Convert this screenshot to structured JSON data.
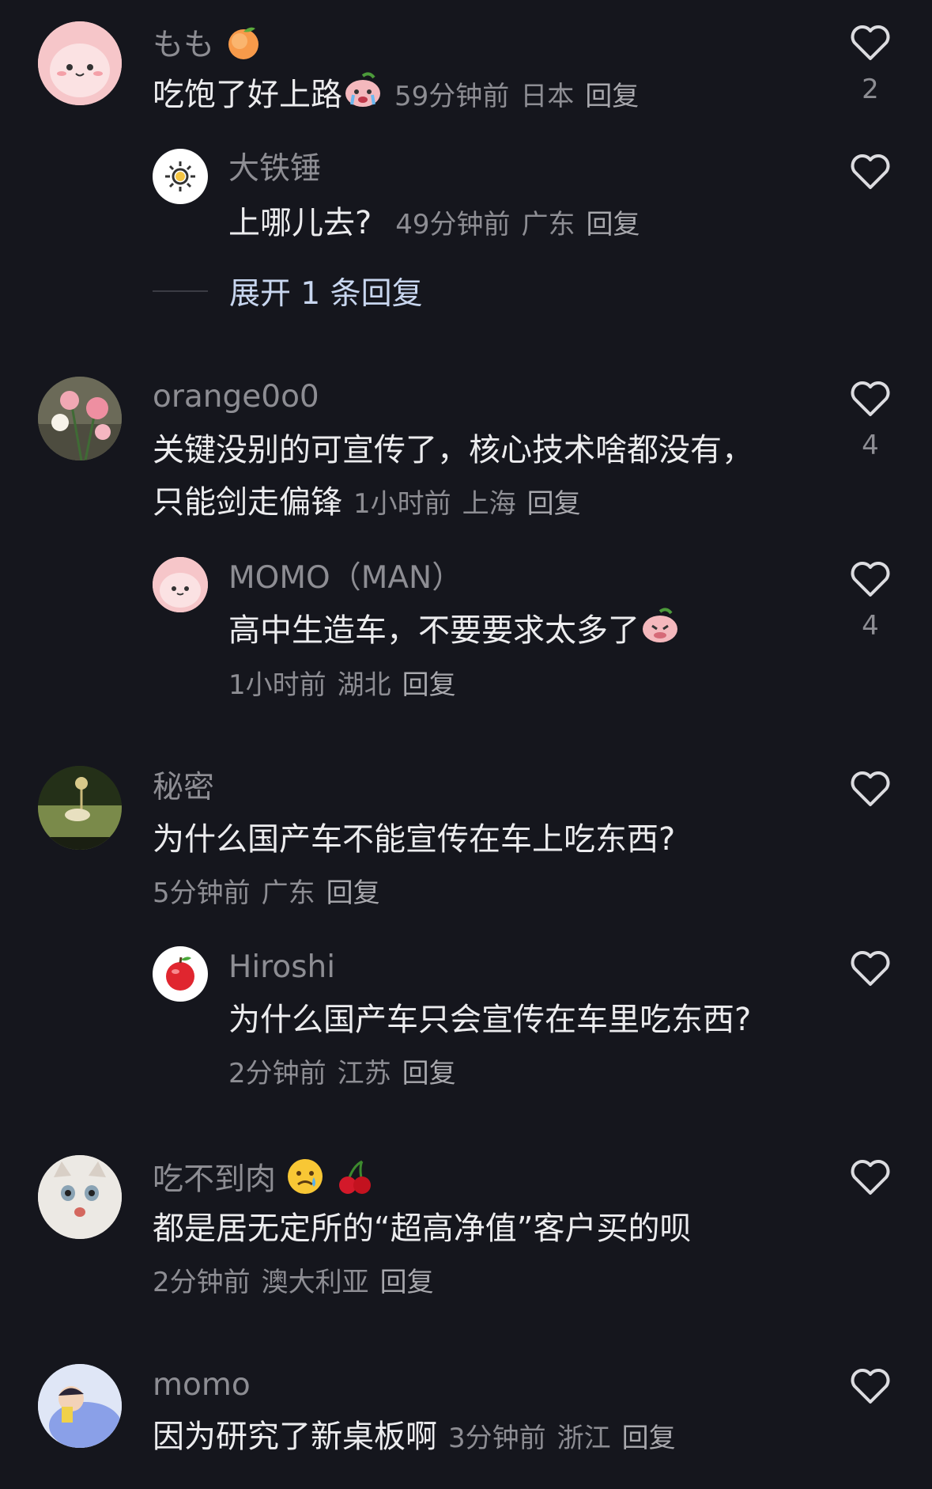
{
  "comments": [
    {
      "name": "もも",
      "text": "吃饱了好上路",
      "time": "59分钟前",
      "region": "日本",
      "reply": "回复",
      "likes": "2"
    },
    {
      "name": "大铁锤",
      "text": "上哪儿去?",
      "time": "49分钟前",
      "region": "广东",
      "reply": "回复",
      "likes": ""
    },
    {
      "name": "orange0o0",
      "text_line1": "关键没别的可宣传了，核心技术啥都没有，",
      "text_line2": "只能剑走偏锋",
      "time": "1小时前",
      "region": "上海",
      "reply": "回复",
      "likes": "4"
    },
    {
      "name": "MOMO（MAN）",
      "text": "高中生造车，不要要求太多了",
      "time": "1小时前",
      "region": "湖北",
      "reply": "回复",
      "likes": "4"
    },
    {
      "name": "秘密",
      "text": "为什么国产车不能宣传在车上吃东西?",
      "time": "5分钟前",
      "region": "广东",
      "reply": "回复",
      "likes": ""
    },
    {
      "name": "Hiroshi",
      "text": "为什么国产车只会宣传在车里吃东西?",
      "time": "2分钟前",
      "region": "江苏",
      "reply": "回复",
      "likes": ""
    },
    {
      "name": "吃不到肉",
      "text": "都是居无定所的“超高净值”客户买的呗",
      "time": "2分钟前",
      "region": "澳大利亚",
      "reply": "回复",
      "likes": ""
    },
    {
      "name": "momo",
      "text": "因为研究了新桌板啊",
      "time": "3分钟前",
      "region": "浙江",
      "reply": "回复",
      "likes": ""
    }
  ],
  "expand_replies": "展开 1 条回复",
  "colors": {
    "background": "#15161d",
    "text": "#ececee",
    "secondary": "#8d8d93",
    "link": "#c8d6ef"
  },
  "icons": [
    "heart-outline-icon",
    "peach-emoji",
    "crying-emoji",
    "sad-face-emoji",
    "cherry-emoji",
    "pleading-emoji"
  ]
}
